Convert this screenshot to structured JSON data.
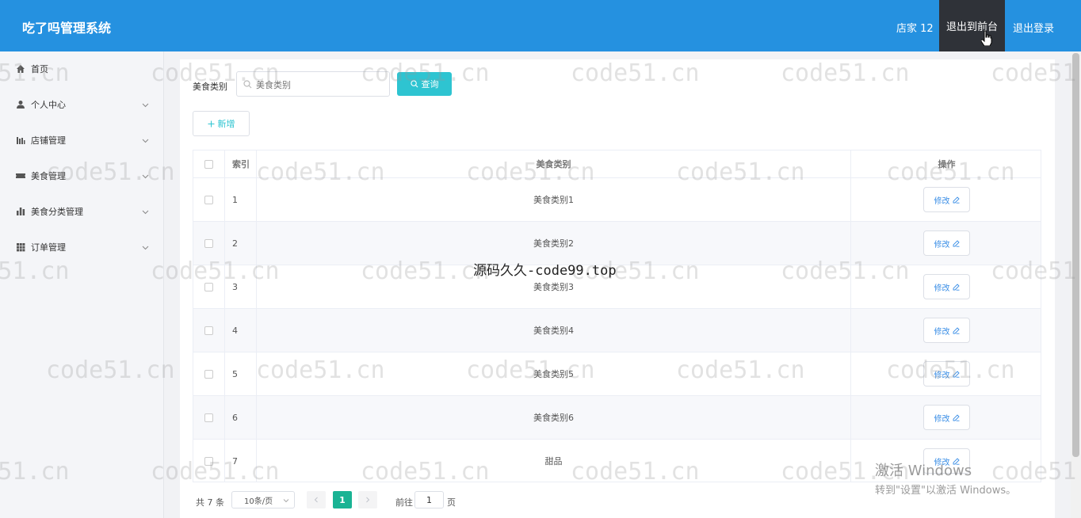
{
  "header": {
    "brand": "吃了吗管理系统",
    "user": "店家 12",
    "front_label": "退出到前台",
    "logout_label": "退出登录"
  },
  "sidebar": {
    "items": [
      {
        "label": "首页",
        "icon": "home-icon"
      },
      {
        "label": "个人中心",
        "icon": "user-icon"
      },
      {
        "label": "店铺管理",
        "icon": "chart-bar-icon"
      },
      {
        "label": "美食管理",
        "icon": "ticket-icon"
      },
      {
        "label": "美食分类管理",
        "icon": "bar-chart-icon"
      },
      {
        "label": "订单管理",
        "icon": "grid-icon"
      }
    ]
  },
  "search": {
    "label": "美食类别",
    "placeholder": "美食类别",
    "button_label": "查询"
  },
  "add_label": "新增",
  "table": {
    "headers": [
      "索引",
      "美食类别",
      "操作"
    ],
    "edit_label": "修改",
    "rows": [
      {
        "index": "1",
        "name": "美食类别1"
      },
      {
        "index": "2",
        "name": "美食类别2"
      },
      {
        "index": "3",
        "name": "美食类别3"
      },
      {
        "index": "4",
        "name": "美食类别4"
      },
      {
        "index": "5",
        "name": "美食类别5"
      },
      {
        "index": "6",
        "name": "美食类别6"
      },
      {
        "index": "7",
        "name": "甜品"
      }
    ]
  },
  "pagination": {
    "total": "共 7 条",
    "page_size": "10条/页",
    "current": "1",
    "goto_label": "前往",
    "goto_value": "1",
    "page_suffix": "页"
  },
  "watermark": {
    "text": "code51.cn",
    "center": "源码久久-code99.top"
  },
  "windows_activation": {
    "line1": "激活 Windows",
    "line2": "转到\"设置\"以激活 Windows。"
  },
  "colors": {
    "header": "#2591e0",
    "active_header_item": "#2f3238",
    "search_button": "#2ec4d1",
    "pager_current": "#1ab394"
  }
}
